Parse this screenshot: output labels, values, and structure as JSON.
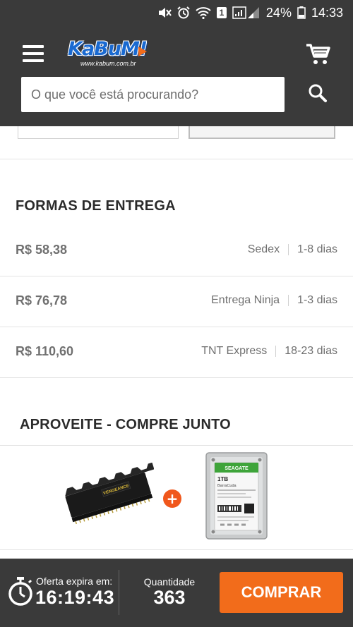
{
  "status_bar": {
    "battery_percent": "24%",
    "time": "14:33",
    "sim_badge": "1",
    "icons": [
      "mute-icon",
      "alarm-icon",
      "wifi-icon",
      "signal-icon",
      "battery-icon"
    ]
  },
  "header": {
    "logo_text": "KaBuM!",
    "logo_subtext": "www.kabum.com.br",
    "search_placeholder": "O que você está procurando?",
    "colors": {
      "background": "#3a3a3a",
      "logo_blue": "#1a6ad1",
      "accent": "#f26c1b"
    }
  },
  "delivery": {
    "title": "FORMAS DE ENTREGA",
    "options": [
      {
        "price": "R$ 58,38",
        "carrier": "Sedex",
        "time": "1-8 dias"
      },
      {
        "price": "R$ 76,78",
        "carrier": "Entrega Ninja",
        "time": "1-3 dias"
      },
      {
        "price": "R$ 110,60",
        "carrier": "TNT Express",
        "time": "18-23 dias"
      }
    ]
  },
  "buy_together": {
    "title": "APROVEITE - COMPRE JUNTO",
    "plus": "+",
    "product_1": {
      "label": "VENGEANCE"
    },
    "product_2": {
      "brand": "SEAGATE",
      "capacity": "1TB",
      "line": "BarraCuda"
    }
  },
  "bottom_bar": {
    "offer_label": "Oferta expira em:",
    "offer_time": "16:19:43",
    "quantity_label": "Quantidade",
    "quantity_value": "363",
    "buy_label": "COMPRAR",
    "buy_color": "#f26c1b"
  }
}
